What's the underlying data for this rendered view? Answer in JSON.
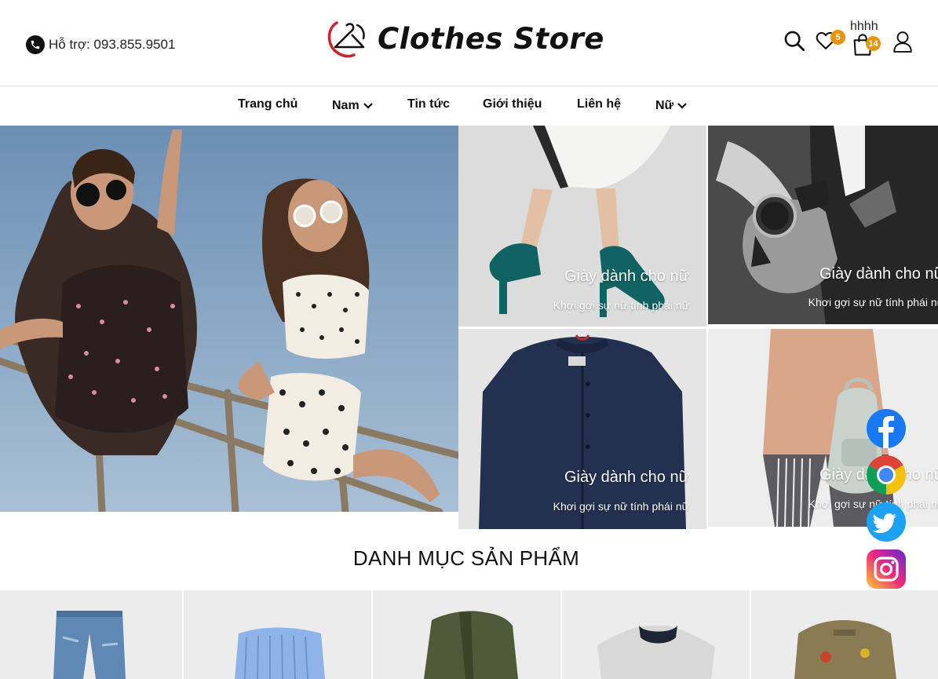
{
  "header": {
    "support_text": "Hỗ trợ: 093.855.9501",
    "logo_text": "Clothes Store",
    "user_name": "hhhh",
    "wishlist_count": "5",
    "cart_count": "14",
    "badge_color": "#e8940f",
    "icons": [
      "phone-icon",
      "search-icon",
      "heart-icon",
      "shopping-bag-icon",
      "user-icon"
    ]
  },
  "nav": {
    "items": [
      {
        "label": "Trang chủ",
        "dropdown": false
      },
      {
        "label": "Nam",
        "dropdown": true
      },
      {
        "label": "Tin tức",
        "dropdown": false
      },
      {
        "label": "Giới thiệu",
        "dropdown": false
      },
      {
        "label": "Liên hệ",
        "dropdown": false
      },
      {
        "label": "Nữ",
        "dropdown": true
      }
    ]
  },
  "banner": {
    "tiles": [
      {
        "title": "Giày dành cho nữ",
        "subtitle": "Khơi gợi sự nữ tính phái nữ"
      },
      {
        "title": "Giày dành cho nữ",
        "subtitle": "Khơi gợi sự nữ tính phái nữ"
      },
      {
        "title": "Giày dành cho nữ",
        "subtitle": "Khơi gợi sự nữ tính phái nữ"
      },
      {
        "title": "Giày dành cho nữ",
        "subtitle": "Khơi gợi sự nữ tính phái nữ"
      }
    ]
  },
  "section": {
    "title": "DANH MỤC SẢN PHẨM"
  },
  "social": [
    "facebook-icon",
    "chrome-icon",
    "twitter-icon",
    "instagram-icon"
  ]
}
